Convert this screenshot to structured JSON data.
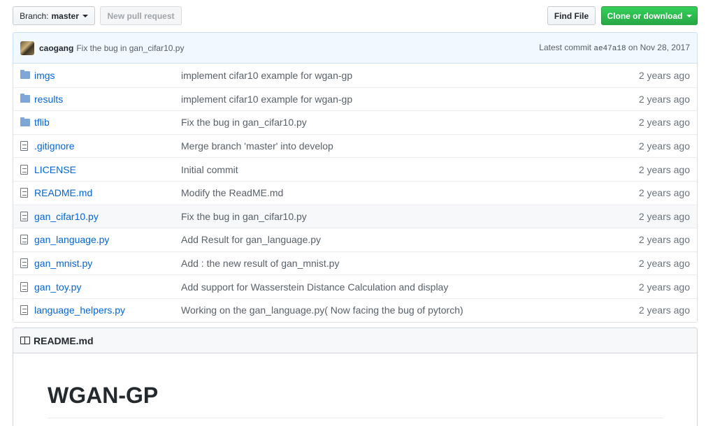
{
  "toolbar": {
    "branch_prefix": "Branch:",
    "branch_name": "master",
    "new_pull_request": "New pull request",
    "find_file": "Find File",
    "clone_download": "Clone or download"
  },
  "commit": {
    "author": "caogang",
    "message": "Fix the bug in gan_cifar10.py",
    "latest_label": "Latest commit",
    "sha": "ae47a18",
    "on_label": "on",
    "date": "Nov 28, 2017"
  },
  "files": [
    {
      "type": "dir",
      "name": "imgs",
      "message": "implement cifar10 example for wgan-gp",
      "age": "2 years ago"
    },
    {
      "type": "dir",
      "name": "results",
      "message": "implement cifar10 example for wgan-gp",
      "age": "2 years ago"
    },
    {
      "type": "dir",
      "name": "tflib",
      "message": "Fix the bug in gan_cifar10.py",
      "age": "2 years ago"
    },
    {
      "type": "file",
      "name": ".gitignore",
      "message": "Merge branch 'master' into develop",
      "age": "2 years ago"
    },
    {
      "type": "file",
      "name": "LICENSE",
      "message": "Initial commit",
      "age": "2 years ago"
    },
    {
      "type": "file",
      "name": "README.md",
      "message": "Modify the ReadME.md",
      "age": "2 years ago"
    },
    {
      "type": "file",
      "name": "gan_cifar10.py",
      "message": "Fix the bug in gan_cifar10.py",
      "age": "2 years ago"
    },
    {
      "type": "file",
      "name": "gan_language.py",
      "message": "Add Result for gan_language.py",
      "age": "2 years ago"
    },
    {
      "type": "file",
      "name": "gan_mnist.py",
      "message": "Add : the new result of gan_mnist.py",
      "age": "2 years ago"
    },
    {
      "type": "file",
      "name": "gan_toy.py",
      "message": "Add support for Wasserstein Distance Calculation and display",
      "age": "2 years ago"
    },
    {
      "type": "file",
      "name": "language_helpers.py",
      "message": "Working on the gan_language.py( Now facing the bug of pytorch)",
      "age": "2 years ago"
    }
  ],
  "highlighted_row": "gan_cifar10.py",
  "readme": {
    "filename": "README.md",
    "title": "WGAN-GP"
  },
  "colors": {
    "link": "#0366d6",
    "clone_green": "#28a745",
    "commit_bar": "#f1f8ff"
  },
  "icons": {
    "folder": "folder-icon",
    "file": "file-icon",
    "book": "book-icon"
  }
}
